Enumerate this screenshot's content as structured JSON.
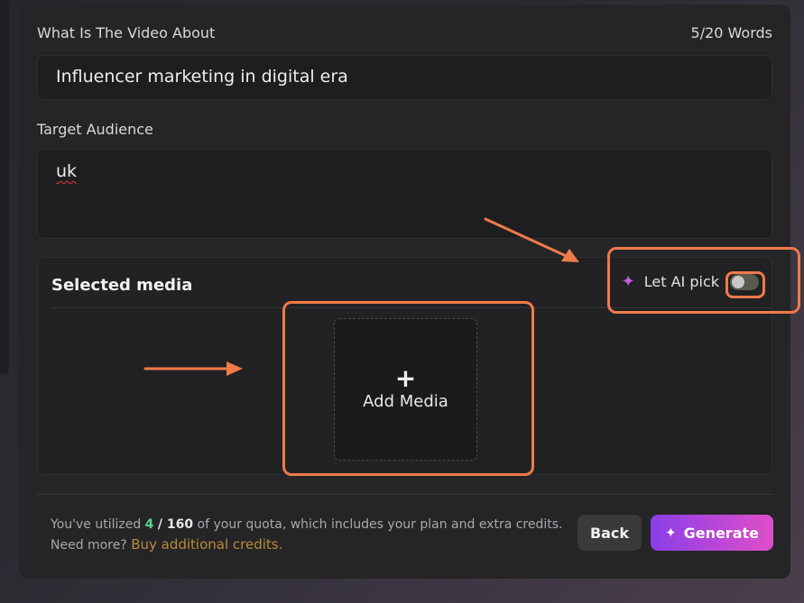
{
  "form": {
    "topic_label": "What Is The Video About",
    "word_count": "5/20 Words",
    "topic_value": "Influencer marketing in digital era",
    "audience_label": "Target Audience",
    "audience_value": "uk"
  },
  "media": {
    "title": "Selected media",
    "ai_pick_label": "Let AI pick",
    "ai_pick_enabled": false,
    "add_media_label": "Add Media",
    "sparkle_icon": "sparkle-icon",
    "plus_icon": "plus-icon"
  },
  "footer": {
    "quota_prefix": "You've utilized",
    "quota_used": "4",
    "quota_total": "/ 160",
    "quota_suffix": "of your quota, which includes your plan and extra credits.",
    "need_more": "Need more?",
    "buy_link": "Buy additional credits.",
    "back_label": "Back",
    "generate_label": "Generate"
  },
  "colors": {
    "accent_orange": "#f07a4a",
    "generate_start": "#8b3ee8",
    "generate_end": "#e04ec8",
    "quota_used": "#5fd08a",
    "link": "#b98a3a"
  }
}
